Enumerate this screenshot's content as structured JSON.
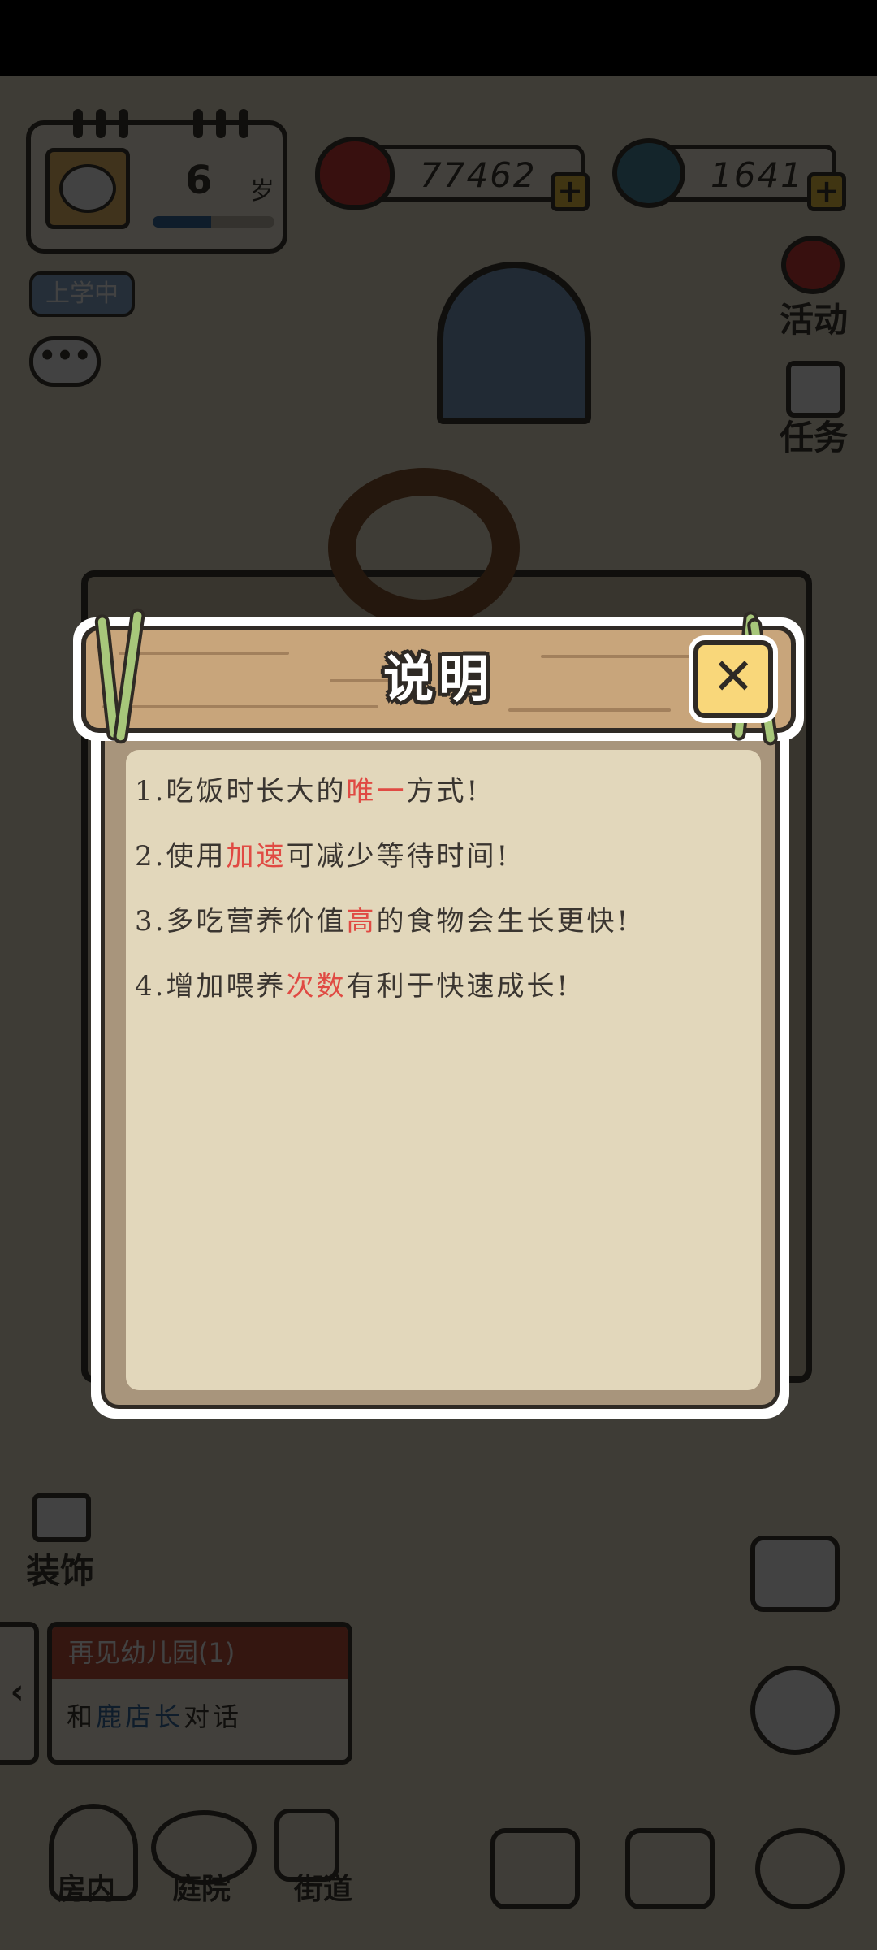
{
  "hud": {
    "age": "6",
    "age_unit": "岁",
    "age_progress": 0.48,
    "hearts": "77462",
    "gems": "1641",
    "status_badge": "上学中"
  },
  "side_menu": {
    "activity": "活动",
    "task": "任务",
    "decorate": "装饰"
  },
  "quest": {
    "title": "再见幼儿园(1)",
    "desc_prefix": "和",
    "desc_highlight": "鹿店长",
    "desc_suffix": "对话"
  },
  "bottom_nav": {
    "room": "房内",
    "garden": "庭院",
    "street": "街道"
  },
  "dialog": {
    "title": "说明",
    "rules": [
      {
        "pre": "1.吃饭时长大的",
        "hl": "唯一",
        "post": "方式!"
      },
      {
        "pre": "2.使用",
        "hl": "加速",
        "post": "可减少等待时间!"
      },
      {
        "pre": "3.多吃营养价值",
        "hl": "高",
        "post": "的食物会生长更快!"
      },
      {
        "pre": "4.增加喂养",
        "hl": "次数",
        "post": "有利于快速成长!"
      }
    ]
  },
  "colors": {
    "highlight": "#e04a43",
    "paper": "#e2d7bb",
    "wood": "#c8a57b",
    "button": "#f9d77a"
  }
}
